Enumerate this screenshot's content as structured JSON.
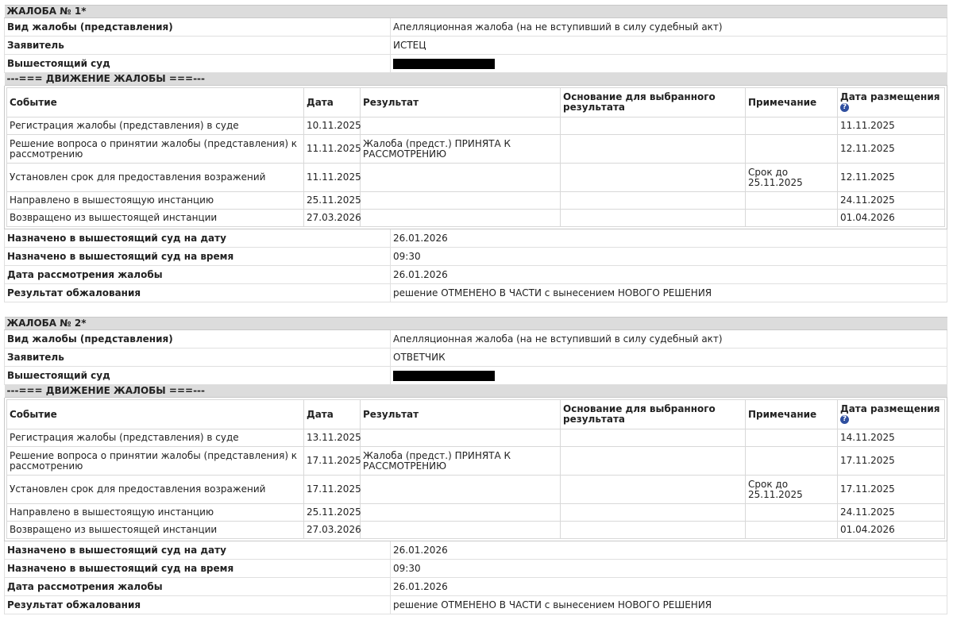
{
  "labels": {
    "kind": "Вид жалобы (представления)",
    "applicant": "Заявитель",
    "court": "Вышестоящий суд",
    "movement": "---=== ДВИЖЕНИЕ ЖАЛОБЫ ===---",
    "col_event": "Событие",
    "col_date": "Дата",
    "col_result": "Результат",
    "col_basis": "Основание для выбранного результата",
    "col_note": "Примечание",
    "col_posted": "Дата размещения",
    "help_glyph": "?",
    "sched_date": "Назначено в вышестоящий суд на дату",
    "sched_time": "Назначено в вышестоящий суд на время",
    "review_date": "Дата рассмотрения жалобы",
    "appeal_result": "Результат обжалования"
  },
  "appeals": [
    {
      "title": "ЖАЛОБА № 1*",
      "kind": "Апелляционная жалоба (на не вступивший в силу судебный акт)",
      "applicant": "ИСТЕЦ",
      "events": [
        {
          "event": "Регистрация жалобы (представления) в суде",
          "date": "10.11.2025",
          "result": "",
          "basis": "",
          "note": "",
          "posted": "11.11.2025"
        },
        {
          "event": "Решение вопроса о принятии жалобы (представления) к рассмотрению",
          "date": "11.11.2025",
          "result": "Жалоба (предст.) ПРИНЯТА К РАССМОТРЕНИЮ",
          "basis": "",
          "note": "",
          "posted": "12.11.2025"
        },
        {
          "event": "Установлен срок для предоставления возражений",
          "date": "11.11.2025",
          "result": "",
          "basis": "",
          "note": "Срок до 25.11.2025",
          "posted": "12.11.2025"
        },
        {
          "event": "Направлено в вышестоящую инстанцию",
          "date": "25.11.2025",
          "result": "",
          "basis": "",
          "note": "",
          "posted": "24.11.2025"
        },
        {
          "event": "Возвращено из вышестоящей инстанции",
          "date": "27.03.2026",
          "result": "",
          "basis": "",
          "note": "",
          "posted": "01.04.2026"
        }
      ],
      "sched_date": "26.01.2026",
      "sched_time": "09:30",
      "review_date": "26.01.2026",
      "appeal_result": "решение ОТМЕНЕНО В ЧАСТИ с вынесением НОВОГО РЕШЕНИЯ"
    },
    {
      "title": "ЖАЛОБА № 2*",
      "kind": "Апелляционная жалоба (на не вступивший в силу судебный акт)",
      "applicant": "ОТВЕТЧИК",
      "events": [
        {
          "event": "Регистрация жалобы (представления) в суде",
          "date": "13.11.2025",
          "result": "",
          "basis": "",
          "note": "",
          "posted": "14.11.2025"
        },
        {
          "event": "Решение вопроса о принятии жалобы (представления) к рассмотрению",
          "date": "17.11.2025",
          "result": "Жалоба (предст.) ПРИНЯТА К РАССМОТРЕНИЮ",
          "basis": "",
          "note": "",
          "posted": "17.11.2025"
        },
        {
          "event": "Установлен срок для предоставления возражений",
          "date": "17.11.2025",
          "result": "",
          "basis": "",
          "note": "Срок до 25.11.2025",
          "posted": "17.11.2025"
        },
        {
          "event": "Направлено в вышестоящую инстанцию",
          "date": "25.11.2025",
          "result": "",
          "basis": "",
          "note": "",
          "posted": "24.11.2025"
        },
        {
          "event": "Возвращено из вышестоящей инстанции",
          "date": "27.03.2026",
          "result": "",
          "basis": "",
          "note": "",
          "posted": "01.04.2026"
        }
      ],
      "sched_date": "26.01.2026",
      "sched_time": "09:30",
      "review_date": "26.01.2026",
      "appeal_result": "решение ОТМЕНЕНО В ЧАСТИ с вынесением НОВОГО РЕШЕНИЯ"
    }
  ]
}
